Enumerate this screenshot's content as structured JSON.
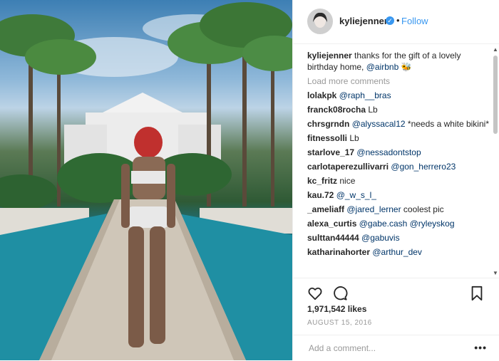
{
  "post": {
    "username": "kyliejenner",
    "follow_label": "Follow",
    "separator": "•",
    "verified_icon": "check-icon",
    "caption_user": "kyliejenner",
    "caption_text": " thanks for the gift of a lovely birthday home, ",
    "caption_mention": "@airbnb",
    "caption_emoji": "🐝",
    "load_more": "Load more comments",
    "comments": [
      {
        "user": "lolakpk",
        "mention": "@raph__bras",
        "text": ""
      },
      {
        "user": "franck08rocha",
        "mention": "",
        "text": " Lb"
      },
      {
        "user": "chrsgrndn",
        "mention": "@alyssacal12",
        "text": " *needs a white bikini*"
      },
      {
        "user": "fitnessolli",
        "mention": "",
        "text": " Lb"
      },
      {
        "user": "starlove_17",
        "mention": "@nessadontstop",
        "text": ""
      },
      {
        "user": "carlotaperezullivarri",
        "mention": "@gon_herrero23",
        "text": ""
      },
      {
        "user": "kc_fritz",
        "mention": "",
        "text": " nice"
      },
      {
        "user": "kau.72",
        "mention": "@_w_s_l_",
        "text": ""
      },
      {
        "user": "_ameliaff",
        "mention": "@jared_lerner",
        "text": " coolest pic"
      },
      {
        "user": "alexa_curtis",
        "mention": "@gabe.cash @ryleyskog",
        "text": ""
      },
      {
        "user": "sulttan44444",
        "mention": "@gabuvis",
        "text": ""
      },
      {
        "user": "katharinahorter",
        "mention": "@arthur_dev",
        "text": ""
      }
    ],
    "likes": "1,971,542 likes",
    "date": "AUGUST 15, 2016",
    "add_comment_placeholder": "Add a comment...",
    "more_label": "•••",
    "colors": {
      "link": "#3897f0",
      "mention": "#003569",
      "muted": "#999999"
    }
  }
}
